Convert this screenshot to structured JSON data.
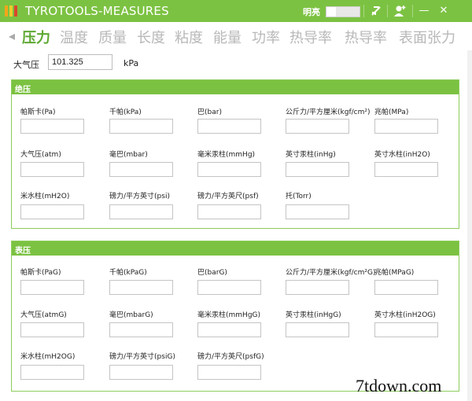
{
  "window": {
    "title": "TYROTOOLS-MEASURES",
    "user": "明亮",
    "minimize": "—",
    "close": "✕"
  },
  "nav": {
    "arrow": "◂",
    "tabs": [
      "压力",
      "温度",
      "质量",
      "长度",
      "粘度",
      "能量",
      "功率",
      "热导率",
      "热导率",
      "表面张力"
    ],
    "active_index": 0
  },
  "atm": {
    "label": "大气压",
    "value": "101.325",
    "unit": "kPa"
  },
  "absolute": {
    "title": "绝压",
    "fields": [
      "帕斯卡(Pa)",
      "千帕(kPa)",
      "巴(bar)",
      "公斤力/平方厘米(kgf/cm²)",
      "兆帕(MPa)",
      "大气压(atm)",
      "毫巴(mbar)",
      "毫米汞柱(mmHg)",
      "英寸汞柱(inHg)",
      "英寸水柱(inH2O)",
      "米水柱(mH2O)",
      "磅力/平方英寸(psi)",
      "磅力/平方英尺(psf)",
      "托(Torr)"
    ]
  },
  "gauge": {
    "title": "表压",
    "fields": [
      "帕斯卡(PaG)",
      "千帕(kPaG)",
      "巴(barG)",
      "公斤力/平方厘米(kgf/cm²G)",
      "兆帕(MPaG)",
      "大气压(atmG)",
      "毫巴(mbarG)",
      "毫米汞柱(mmHgG)",
      "英寸汞柱(inHgG)",
      "英寸水柱(inH2OG)",
      "米水柱(mH2OG)",
      "磅力/平方英寸(psiG)",
      "磅力/平方英尺(psfG)"
    ]
  },
  "watermark": "7tdown.com",
  "colors": {
    "accent": "#7cc242",
    "active_tab": "#5da832",
    "inactive_tab": "#b8b8b8"
  }
}
